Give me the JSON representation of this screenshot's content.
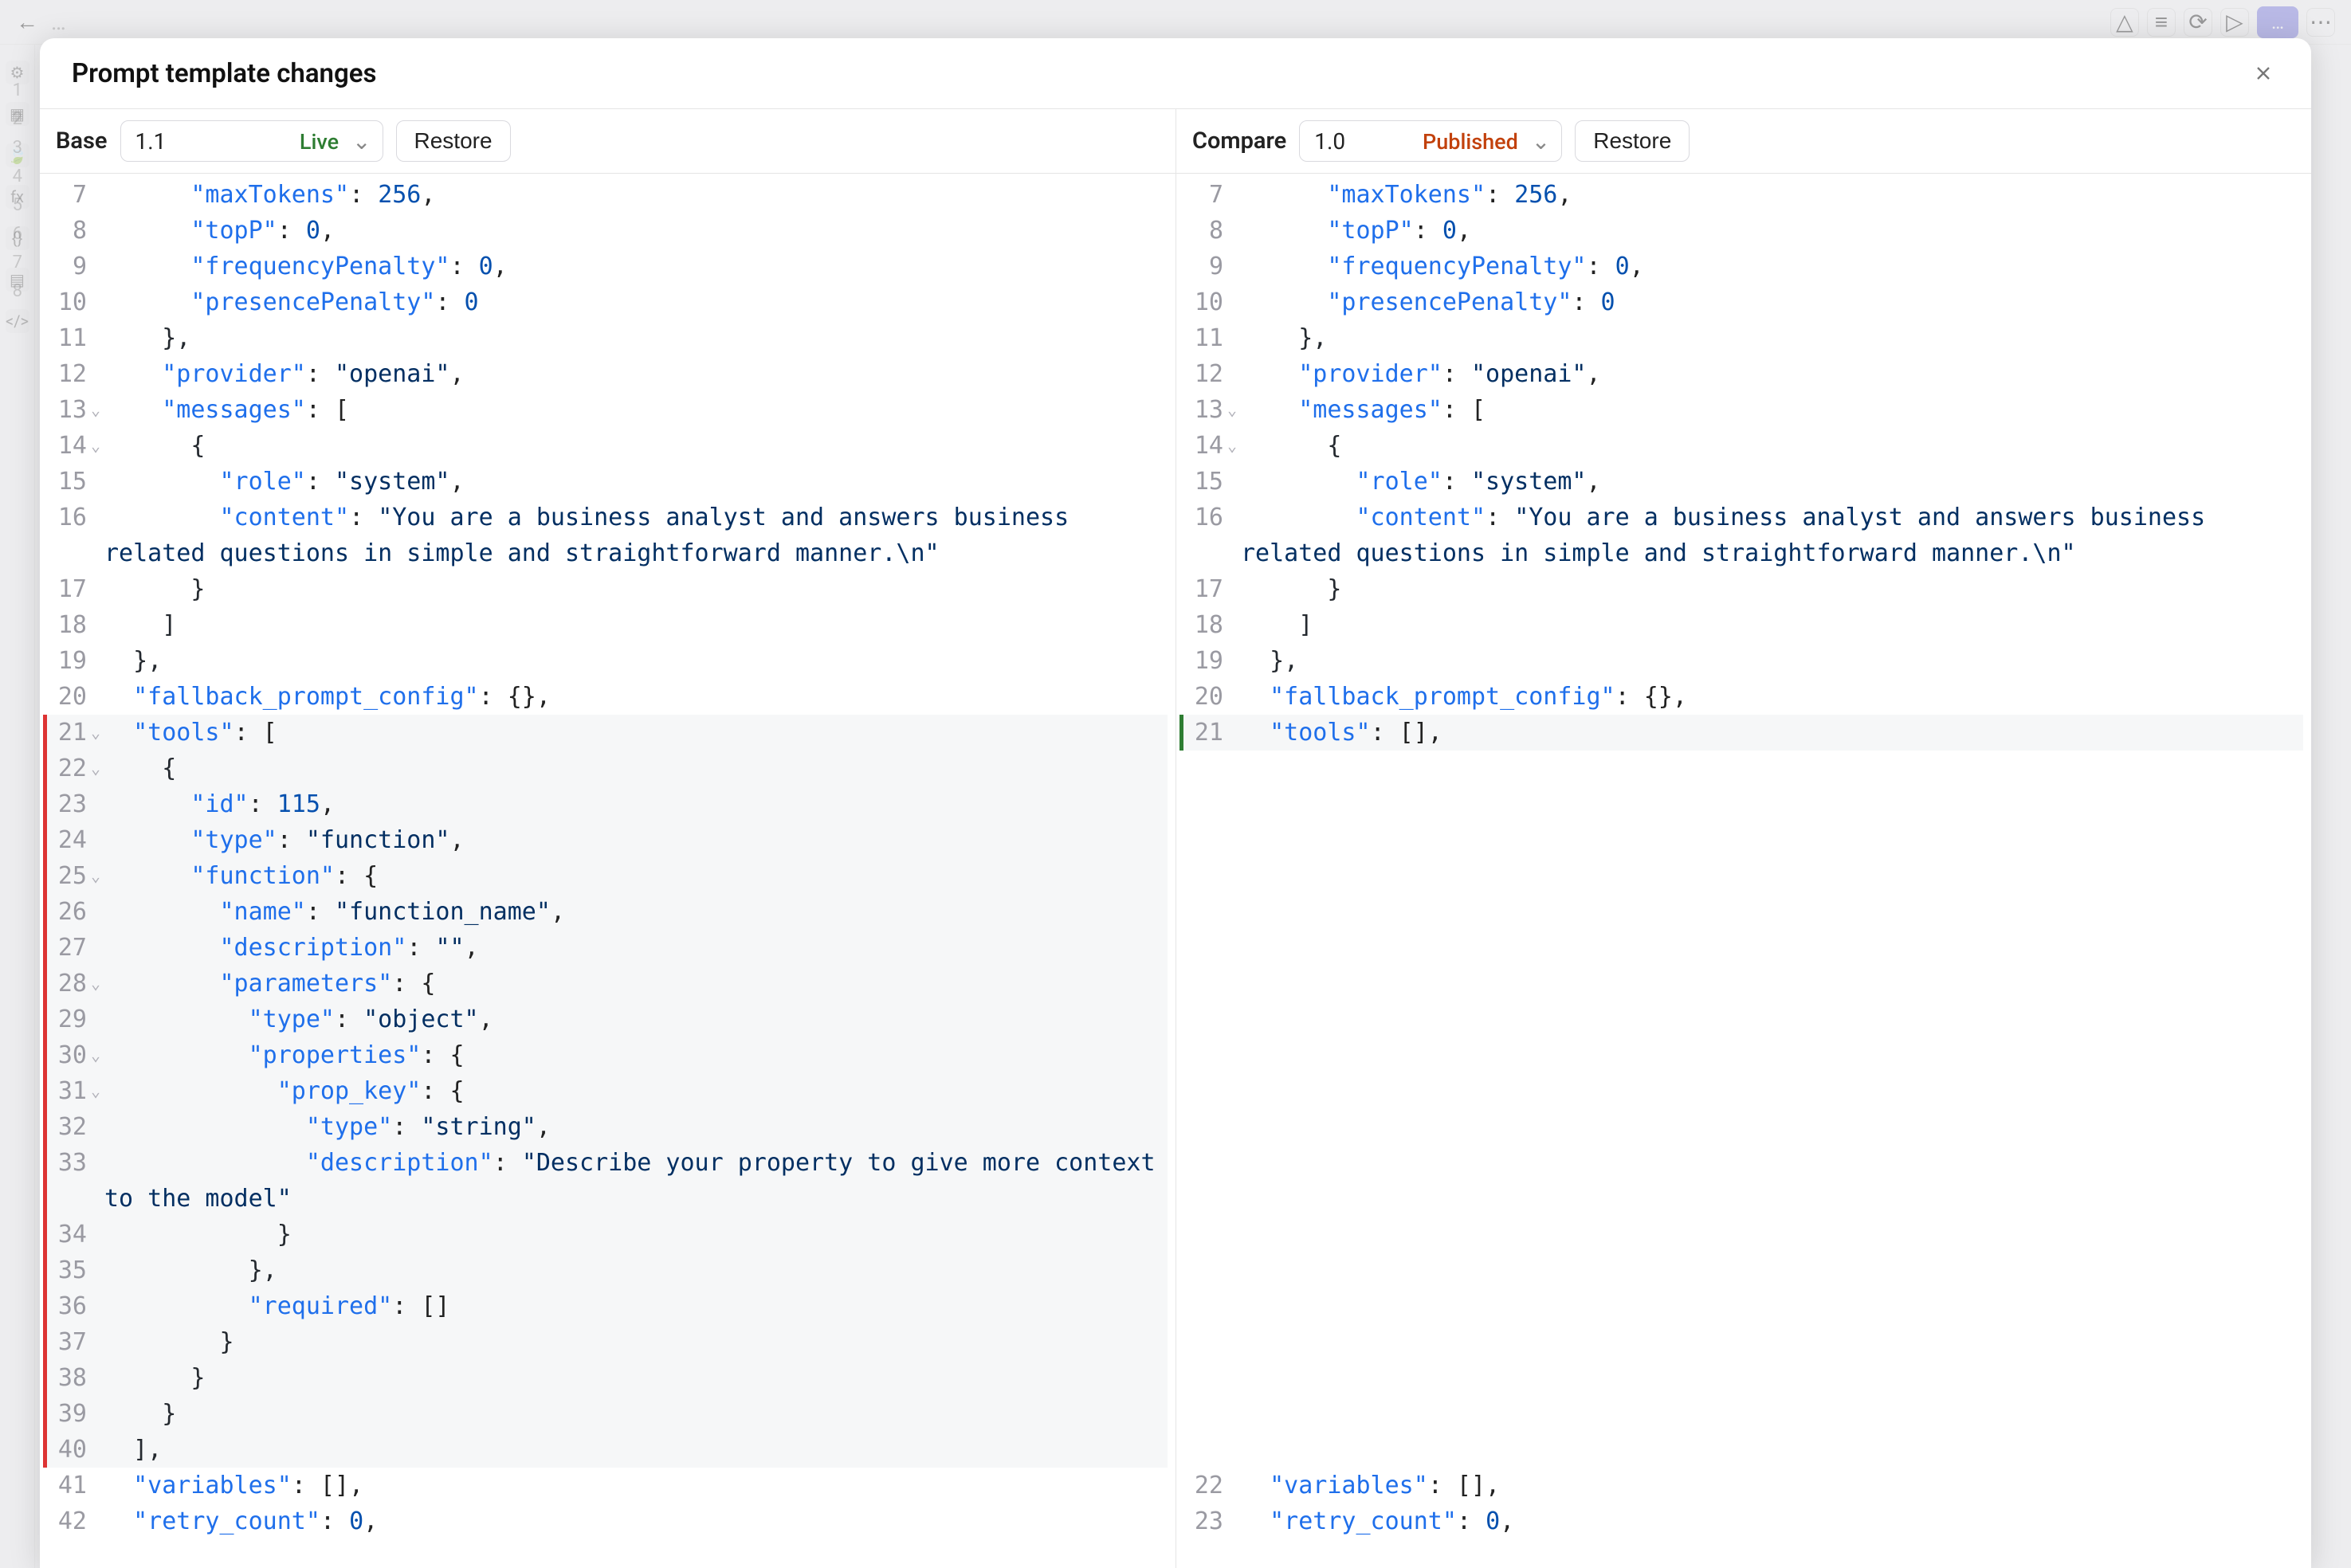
{
  "modal": {
    "title": "Prompt template changes",
    "base_label": "Base",
    "compare_label": "Compare",
    "restore_label": "Restore",
    "base_version": "1.1",
    "base_status": "Live",
    "compare_version": "1.0",
    "compare_status": "Published"
  },
  "left_lines": [
    {
      "n": 7,
      "fold": "",
      "hl": "plain",
      "spans": [
        [
          "plain",
          "      "
        ],
        [
          "key",
          "\"maxTokens\""
        ],
        [
          "punc",
          ": "
        ],
        [
          "num",
          "256"
        ],
        [
          "punc",
          ","
        ]
      ]
    },
    {
      "n": 8,
      "fold": "",
      "hl": "plain",
      "spans": [
        [
          "plain",
          "      "
        ],
        [
          "key",
          "\"topP\""
        ],
        [
          "punc",
          ": "
        ],
        [
          "num",
          "0"
        ],
        [
          "punc",
          ","
        ]
      ]
    },
    {
      "n": 9,
      "fold": "",
      "hl": "plain",
      "spans": [
        [
          "plain",
          "      "
        ],
        [
          "key",
          "\"frequencyPenalty\""
        ],
        [
          "punc",
          ": "
        ],
        [
          "num",
          "0"
        ],
        [
          "punc",
          ","
        ]
      ]
    },
    {
      "n": 10,
      "fold": "",
      "hl": "plain",
      "spans": [
        [
          "plain",
          "      "
        ],
        [
          "key",
          "\"presencePenalty\""
        ],
        [
          "punc",
          ": "
        ],
        [
          "num",
          "0"
        ]
      ]
    },
    {
      "n": 11,
      "fold": "",
      "hl": "plain",
      "spans": [
        [
          "plain",
          "    },"
        ]
      ]
    },
    {
      "n": 12,
      "fold": "",
      "hl": "plain",
      "spans": [
        [
          "plain",
          "    "
        ],
        [
          "key",
          "\"provider\""
        ],
        [
          "punc",
          ": "
        ],
        [
          "str",
          "\"openai\""
        ],
        [
          "punc",
          ","
        ]
      ]
    },
    {
      "n": 13,
      "fold": "v",
      "hl": "plain",
      "spans": [
        [
          "plain",
          "    "
        ],
        [
          "key",
          "\"messages\""
        ],
        [
          "punc",
          ": ["
        ]
      ]
    },
    {
      "n": 14,
      "fold": "v",
      "hl": "plain",
      "spans": [
        [
          "plain",
          "      {"
        ]
      ]
    },
    {
      "n": 15,
      "fold": "",
      "hl": "plain",
      "spans": [
        [
          "plain",
          "        "
        ],
        [
          "key",
          "\"role\""
        ],
        [
          "punc",
          ": "
        ],
        [
          "str",
          "\"system\""
        ],
        [
          "punc",
          ","
        ]
      ]
    },
    {
      "n": 16,
      "fold": "",
      "hl": "plain",
      "spans": [
        [
          "plain",
          "        "
        ],
        [
          "key",
          "\"content\""
        ],
        [
          "punc",
          ": "
        ],
        [
          "str",
          "\"You are a business analyst and answers business related questions in simple and straightforward manner.\\n\""
        ]
      ]
    },
    {
      "n": 17,
      "fold": "",
      "hl": "plain",
      "spans": [
        [
          "plain",
          "      }"
        ]
      ]
    },
    {
      "n": 18,
      "fold": "",
      "hl": "plain",
      "spans": [
        [
          "plain",
          "    ]"
        ]
      ]
    },
    {
      "n": 19,
      "fold": "",
      "hl": "plain",
      "spans": [
        [
          "plain",
          "  },"
        ]
      ]
    },
    {
      "n": 20,
      "fold": "",
      "hl": "plain",
      "spans": [
        [
          "plain",
          "  "
        ],
        [
          "key",
          "\"fallback_prompt_config\""
        ],
        [
          "punc",
          ": {},"
        ]
      ]
    },
    {
      "n": 21,
      "fold": "v",
      "hl": "red",
      "spans": [
        [
          "plain",
          "  "
        ],
        [
          "key",
          "\"tools\""
        ],
        [
          "punc",
          ": ["
        ]
      ]
    },
    {
      "n": 22,
      "fold": "v",
      "hl": "red",
      "spans": [
        [
          "plain",
          "    {"
        ]
      ]
    },
    {
      "n": 23,
      "fold": "",
      "hl": "red",
      "spans": [
        [
          "plain",
          "      "
        ],
        [
          "key",
          "\"id\""
        ],
        [
          "punc",
          ": "
        ],
        [
          "num",
          "115"
        ],
        [
          "punc",
          ","
        ]
      ]
    },
    {
      "n": 24,
      "fold": "",
      "hl": "red",
      "spans": [
        [
          "plain",
          "      "
        ],
        [
          "key",
          "\"type\""
        ],
        [
          "punc",
          ": "
        ],
        [
          "str",
          "\"function\""
        ],
        [
          "punc",
          ","
        ]
      ]
    },
    {
      "n": 25,
      "fold": "v",
      "hl": "red",
      "spans": [
        [
          "plain",
          "      "
        ],
        [
          "key",
          "\"function\""
        ],
        [
          "punc",
          ": {"
        ]
      ]
    },
    {
      "n": 26,
      "fold": "",
      "hl": "red",
      "spans": [
        [
          "plain",
          "        "
        ],
        [
          "key",
          "\"name\""
        ],
        [
          "punc",
          ": "
        ],
        [
          "str",
          "\"function_name\""
        ],
        [
          "punc",
          ","
        ]
      ]
    },
    {
      "n": 27,
      "fold": "",
      "hl": "red",
      "spans": [
        [
          "plain",
          "        "
        ],
        [
          "key",
          "\"description\""
        ],
        [
          "punc",
          ": "
        ],
        [
          "str",
          "\"\""
        ],
        [
          "punc",
          ","
        ]
      ]
    },
    {
      "n": 28,
      "fold": "v",
      "hl": "red",
      "spans": [
        [
          "plain",
          "        "
        ],
        [
          "key",
          "\"parameters\""
        ],
        [
          "punc",
          ": {"
        ]
      ]
    },
    {
      "n": 29,
      "fold": "",
      "hl": "red",
      "spans": [
        [
          "plain",
          "          "
        ],
        [
          "key",
          "\"type\""
        ],
        [
          "punc",
          ": "
        ],
        [
          "str",
          "\"object\""
        ],
        [
          "punc",
          ","
        ]
      ]
    },
    {
      "n": 30,
      "fold": "v",
      "hl": "red",
      "spans": [
        [
          "plain",
          "          "
        ],
        [
          "key",
          "\"properties\""
        ],
        [
          "punc",
          ": {"
        ]
      ]
    },
    {
      "n": 31,
      "fold": "v",
      "hl": "red",
      "spans": [
        [
          "plain",
          "            "
        ],
        [
          "key",
          "\"prop_key\""
        ],
        [
          "punc",
          ": {"
        ]
      ]
    },
    {
      "n": 32,
      "fold": "",
      "hl": "red",
      "spans": [
        [
          "plain",
          "              "
        ],
        [
          "key",
          "\"type\""
        ],
        [
          "punc",
          ": "
        ],
        [
          "str",
          "\"string\""
        ],
        [
          "punc",
          ","
        ]
      ]
    },
    {
      "n": 33,
      "fold": "",
      "hl": "red",
      "spans": [
        [
          "plain",
          "              "
        ],
        [
          "key",
          "\"description\""
        ],
        [
          "punc",
          ": "
        ],
        [
          "str",
          "\"Describe your property to give more context to the model\""
        ]
      ]
    },
    {
      "n": 34,
      "fold": "",
      "hl": "red",
      "spans": [
        [
          "plain",
          "            }"
        ]
      ]
    },
    {
      "n": 35,
      "fold": "",
      "hl": "red",
      "spans": [
        [
          "plain",
          "          },"
        ]
      ]
    },
    {
      "n": 36,
      "fold": "",
      "hl": "red",
      "spans": [
        [
          "plain",
          "          "
        ],
        [
          "key",
          "\"required\""
        ],
        [
          "punc",
          ": []"
        ]
      ]
    },
    {
      "n": 37,
      "fold": "",
      "hl": "red",
      "spans": [
        [
          "plain",
          "        }"
        ]
      ]
    },
    {
      "n": 38,
      "fold": "",
      "hl": "red",
      "spans": [
        [
          "plain",
          "      }"
        ]
      ]
    },
    {
      "n": 39,
      "fold": "",
      "hl": "red",
      "spans": [
        [
          "plain",
          "    }"
        ]
      ]
    },
    {
      "n": 40,
      "fold": "",
      "hl": "red",
      "spans": [
        [
          "plain",
          "  ],"
        ]
      ]
    },
    {
      "n": 41,
      "fold": "",
      "hl": "plain",
      "spans": [
        [
          "plain",
          "  "
        ],
        [
          "key",
          "\"variables\""
        ],
        [
          "punc",
          ": [],"
        ]
      ]
    },
    {
      "n": 42,
      "fold": "",
      "hl": "plain",
      "spans": [
        [
          "plain",
          "  "
        ],
        [
          "key",
          "\"retry_count\""
        ],
        [
          "punc",
          ": "
        ],
        [
          "num",
          "0"
        ],
        [
          "punc",
          ","
        ]
      ]
    }
  ],
  "right_lines": [
    {
      "n": 7,
      "fold": "",
      "hl": "plain",
      "spans": [
        [
          "plain",
          "      "
        ],
        [
          "key",
          "\"maxTokens\""
        ],
        [
          "punc",
          ": "
        ],
        [
          "num",
          "256"
        ],
        [
          "punc",
          ","
        ]
      ]
    },
    {
      "n": 8,
      "fold": "",
      "hl": "plain",
      "spans": [
        [
          "plain",
          "      "
        ],
        [
          "key",
          "\"topP\""
        ],
        [
          "punc",
          ": "
        ],
        [
          "num",
          "0"
        ],
        [
          "punc",
          ","
        ]
      ]
    },
    {
      "n": 9,
      "fold": "",
      "hl": "plain",
      "spans": [
        [
          "plain",
          "      "
        ],
        [
          "key",
          "\"frequencyPenalty\""
        ],
        [
          "punc",
          ": "
        ],
        [
          "num",
          "0"
        ],
        [
          "punc",
          ","
        ]
      ]
    },
    {
      "n": 10,
      "fold": "",
      "hl": "plain",
      "spans": [
        [
          "plain",
          "      "
        ],
        [
          "key",
          "\"presencePenalty\""
        ],
        [
          "punc",
          ": "
        ],
        [
          "num",
          "0"
        ]
      ]
    },
    {
      "n": 11,
      "fold": "",
      "hl": "plain",
      "spans": [
        [
          "plain",
          "    },"
        ]
      ]
    },
    {
      "n": 12,
      "fold": "",
      "hl": "plain",
      "spans": [
        [
          "plain",
          "    "
        ],
        [
          "key",
          "\"provider\""
        ],
        [
          "punc",
          ": "
        ],
        [
          "str",
          "\"openai\""
        ],
        [
          "punc",
          ","
        ]
      ]
    },
    {
      "n": 13,
      "fold": "v",
      "hl": "plain",
      "spans": [
        [
          "plain",
          "    "
        ],
        [
          "key",
          "\"messages\""
        ],
        [
          "punc",
          ": ["
        ]
      ]
    },
    {
      "n": 14,
      "fold": "v",
      "hl": "plain",
      "spans": [
        [
          "plain",
          "      {"
        ]
      ]
    },
    {
      "n": 15,
      "fold": "",
      "hl": "plain",
      "spans": [
        [
          "plain",
          "        "
        ],
        [
          "key",
          "\"role\""
        ],
        [
          "punc",
          ": "
        ],
        [
          "str",
          "\"system\""
        ],
        [
          "punc",
          ","
        ]
      ]
    },
    {
      "n": 16,
      "fold": "",
      "hl": "plain",
      "spans": [
        [
          "plain",
          "        "
        ],
        [
          "key",
          "\"content\""
        ],
        [
          "punc",
          ": "
        ],
        [
          "str",
          "\"You are a business analyst and answers business related questions in simple and straightforward manner.\\n\""
        ]
      ]
    },
    {
      "n": 17,
      "fold": "",
      "hl": "plain",
      "spans": [
        [
          "plain",
          "      }"
        ]
      ]
    },
    {
      "n": 18,
      "fold": "",
      "hl": "plain",
      "spans": [
        [
          "plain",
          "    ]"
        ]
      ]
    },
    {
      "n": 19,
      "fold": "",
      "hl": "plain",
      "spans": [
        [
          "plain",
          "  },"
        ]
      ]
    },
    {
      "n": 20,
      "fold": "",
      "hl": "plain",
      "spans": [
        [
          "plain",
          "  "
        ],
        [
          "key",
          "\"fallback_prompt_config\""
        ],
        [
          "punc",
          ": {},"
        ]
      ]
    },
    {
      "n": 21,
      "fold": "",
      "hl": "green",
      "spans": [
        [
          "plain",
          "  "
        ],
        [
          "key",
          "\"tools\""
        ],
        [
          "punc",
          ": [],"
        ]
      ]
    },
    {
      "n": null,
      "blank": true
    },
    {
      "n": null,
      "blank": true
    },
    {
      "n": null,
      "blank": true
    },
    {
      "n": null,
      "blank": true
    },
    {
      "n": null,
      "blank": true
    },
    {
      "n": null,
      "blank": true
    },
    {
      "n": null,
      "blank": true
    },
    {
      "n": null,
      "blank": true
    },
    {
      "n": null,
      "blank": true
    },
    {
      "n": null,
      "blank": true
    },
    {
      "n": null,
      "blank": true
    },
    {
      "n": null,
      "blank": true
    },
    {
      "n": null,
      "blank": true
    },
    {
      "n": null,
      "blank": true
    },
    {
      "n": null,
      "blank": true
    },
    {
      "n": null,
      "blank": true
    },
    {
      "n": null,
      "blank": true
    },
    {
      "n": null,
      "blank": true
    },
    {
      "n": null,
      "blank": true
    },
    {
      "n": null,
      "blank": true
    },
    {
      "n": 22,
      "fold": "",
      "hl": "plain",
      "spans": [
        [
          "plain",
          "  "
        ],
        [
          "key",
          "\"variables\""
        ],
        [
          "punc",
          ": [],"
        ]
      ]
    },
    {
      "n": 23,
      "fold": "",
      "hl": "plain",
      "spans": [
        [
          "plain",
          "  "
        ],
        [
          "key",
          "\"retry_count\""
        ],
        [
          "punc",
          ": "
        ],
        [
          "num",
          "0"
        ],
        [
          "punc",
          ","
        ]
      ]
    }
  ],
  "bg_line_numbers": [
    "1",
    "2",
    "3",
    "4",
    "5",
    "6",
    "7",
    "8"
  ]
}
